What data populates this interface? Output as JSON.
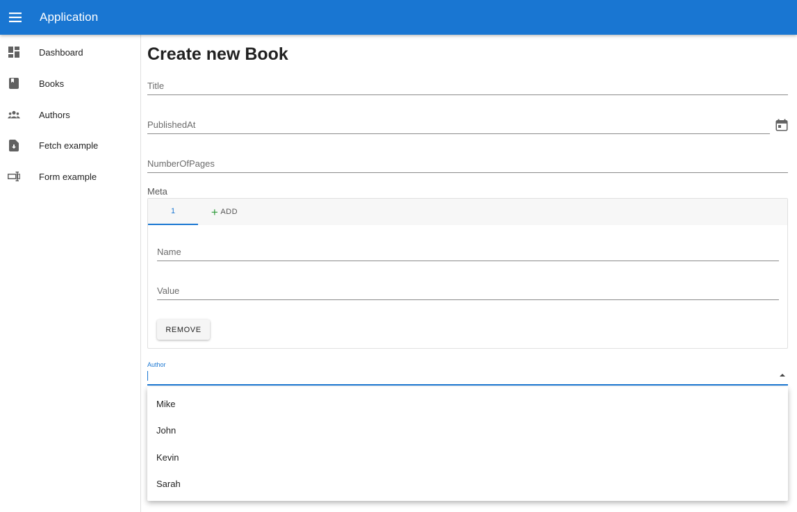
{
  "appbar": {
    "title": "Application",
    "menu_icon": "menu-icon",
    "color": "#1976d2"
  },
  "sidebar": {
    "items": [
      {
        "label": "Dashboard",
        "icon": "dashboard-icon"
      },
      {
        "label": "Books",
        "icon": "book-icon"
      },
      {
        "label": "Authors",
        "icon": "people-icon"
      },
      {
        "label": "Fetch example",
        "icon": "file-download-icon"
      },
      {
        "label": "Form example",
        "icon": "form-icon"
      }
    ]
  },
  "main": {
    "title": "Create new Book",
    "fields": {
      "title": {
        "label": "Title",
        "value": ""
      },
      "published_at": {
        "label": "PublishedAt",
        "value": "",
        "icon": "calendar-icon"
      },
      "number_of_pages": {
        "label": "NumberOfPages",
        "value": ""
      }
    },
    "meta": {
      "label": "Meta",
      "tabs": [
        {
          "label": "1"
        }
      ],
      "add_label": "ADD",
      "name_label": "Name",
      "value_label": "Value",
      "remove_label": "REMOVE"
    },
    "author": {
      "label": "Author",
      "value": "",
      "options": [
        "Mike",
        "John",
        "Kevin",
        "Sarah"
      ]
    }
  },
  "colors": {
    "primary": "#1976d2",
    "add_icon": "#2e9b3a"
  }
}
